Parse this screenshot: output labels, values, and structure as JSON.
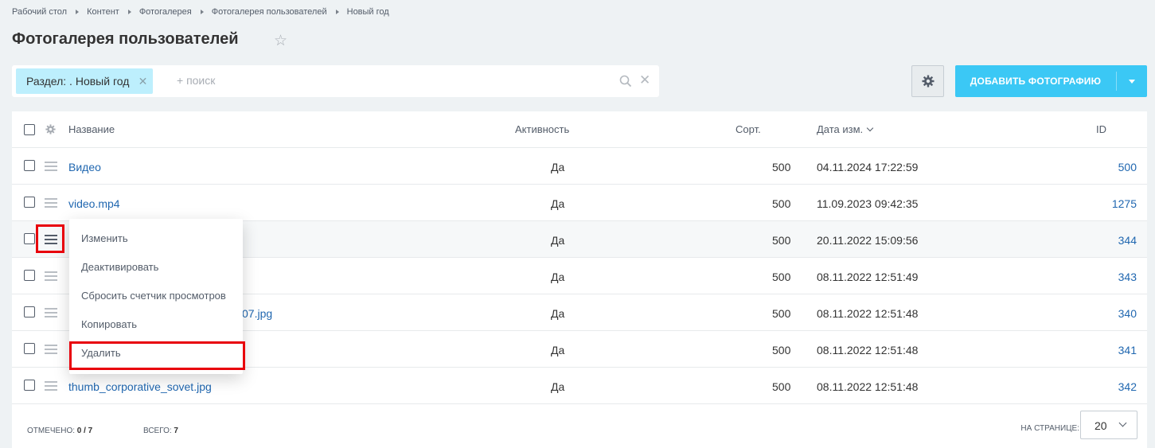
{
  "breadcrumb": [
    "Рабочий стол",
    "Контент",
    "Фотогалерея",
    "Фотогалерея пользователей",
    "Новый год"
  ],
  "page": {
    "title": "Фотогалерея пользователей",
    "star_icon": "star-outline-icon"
  },
  "filter": {
    "chip_label": "Раздел: . Новый год",
    "placeholder": "+ поиск",
    "search_icon": "search-icon",
    "clear_icon": "close-icon"
  },
  "toolbar": {
    "settings_icon": "gear-icon",
    "add_label": "ДОБАВИТЬ ФОТОГРАФИЮ",
    "accent": "#3bc8f5"
  },
  "grid": {
    "columns": {
      "name": "Название",
      "active": "Активность",
      "sort": "Сорт.",
      "date": "Дата изм.",
      "id": "ID"
    },
    "rows": [
      {
        "name": "Видео",
        "active": "Да",
        "sort": "500",
        "date": "04.11.2024 17:22:59",
        "id": "500"
      },
      {
        "name": "video.mp4",
        "active": "Да",
        "sort": "500",
        "date": "11.09.2023 09:42:35",
        "id": "1275"
      },
      {
        "name": "",
        "active": "Да",
        "sort": "500",
        "date": "20.11.2022 15:09:56",
        "id": "344"
      },
      {
        "name": "",
        "active": "Да",
        "sort": "500",
        "date": "08.11.2022 12:51:49",
        "id": "343"
      },
      {
        "name": "07.jpg",
        "active": "Да",
        "sort": "500",
        "date": "08.11.2022 12:51:48",
        "id": "340"
      },
      {
        "name": "",
        "active": "Да",
        "sort": "500",
        "date": "08.11.2022 12:51:48",
        "id": "341"
      },
      {
        "name": "thumb_corporative_sovet.jpg",
        "active": "Да",
        "sort": "500",
        "date": "08.11.2022 12:51:48",
        "id": "342"
      }
    ],
    "footer": {
      "checked_label": "ОТМЕЧЕНО:",
      "checked_value": "0 / 7",
      "total_label": "ВСЕГО:",
      "total_value": "7",
      "per_page_label": "НА СТРАНИЦЕ:",
      "per_page_value": "20"
    }
  },
  "context_menu": {
    "items": [
      "Изменить",
      "Деактивировать",
      "Сбросить счетчик просмотров",
      "Копировать",
      "Удалить"
    ]
  },
  "highlight_color": "#e8000b"
}
